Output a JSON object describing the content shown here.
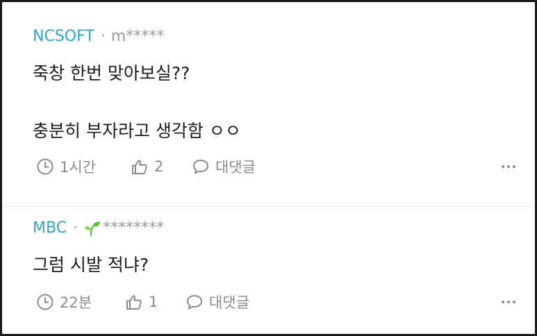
{
  "comments": [
    {
      "company": "NCSOFT",
      "separator": "·",
      "user": "m*****",
      "has_sprout_badge": false,
      "lines": [
        "죽창 한번 맞아보실??",
        "충분히 부자라고 생각함 ㅇㅇ"
      ],
      "time": "1시간",
      "likes": "2",
      "reply_label": "대댓글"
    },
    {
      "company": "MBC",
      "separator": "·",
      "user": "********",
      "has_sprout_badge": true,
      "lines": [
        "그럼 시발 적냐?"
      ],
      "time": "22분",
      "likes": "1",
      "reply_label": "대댓글"
    }
  ],
  "colors": {
    "company": "#33a5c8",
    "meta_gray": "#9a9a9a",
    "body_text": "#1c1c1c",
    "action_gray": "#8a8a8a",
    "sprout_green": "#5bbf3a"
  },
  "icons": {
    "time": "clock-icon",
    "like": "thumbs-up-icon",
    "reply": "speech-bubble-icon",
    "more": "more-dots-icon",
    "badge": "sprout-icon"
  }
}
